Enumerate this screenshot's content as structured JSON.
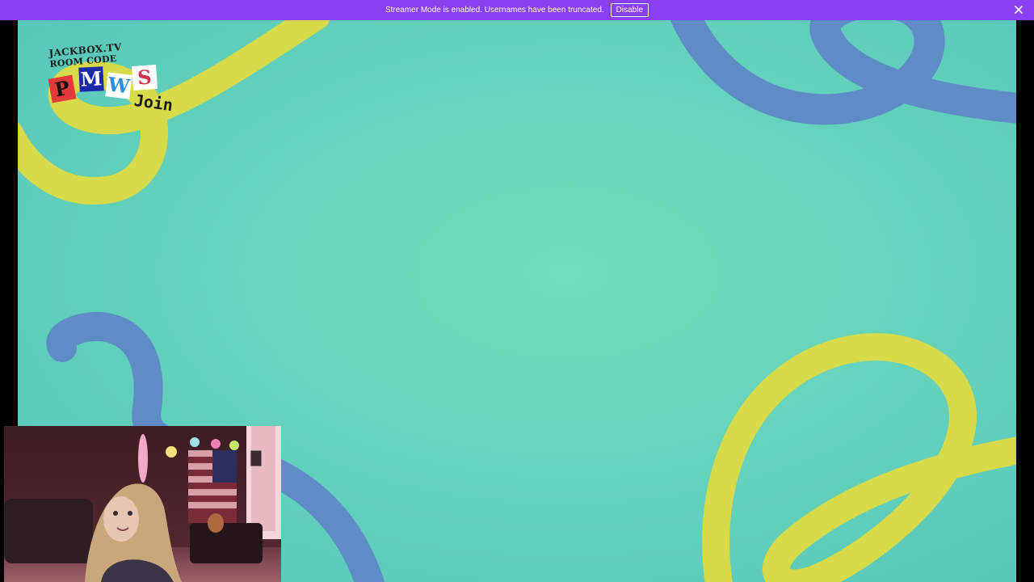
{
  "banner": {
    "message": "Streamer Mode is enabled. Usernames have been truncated.",
    "disable_label": "Disable",
    "close_icon": "close-icon",
    "background": "#8a3ff0"
  },
  "room_code": {
    "site": "JACKBOX.TV",
    "label": "ROOM CODE",
    "letters": [
      "P",
      "M",
      "W",
      "S"
    ],
    "join_label": "Join"
  },
  "colors": {
    "stage_background": "#66d3bd",
    "squiggle_yellow": "#d7da49",
    "squiggle_blue": "#5f8bc7"
  },
  "webcam": {
    "icon": "webcam-feed"
  }
}
